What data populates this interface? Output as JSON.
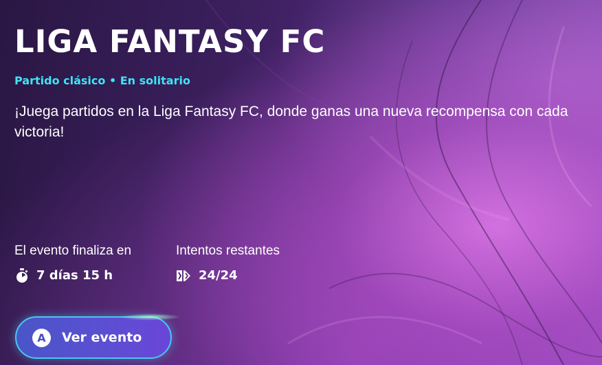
{
  "event": {
    "title": "LIGA FANTASY FC",
    "subtitle": "Partido clásico • En solitario",
    "description": "¡Juega partidos en la Liga Fantasy FC, donde ganas una nueva recompensa con cada victoria!"
  },
  "stats": {
    "end": {
      "label": "El evento finaliza en",
      "value": "7 días 15 h",
      "icon": "stopwatch-icon"
    },
    "attempts": {
      "label": "Intentos restantes",
      "value": "24/24",
      "icon": "attempts-icon"
    }
  },
  "cta": {
    "badge": "A",
    "label": "Ver evento"
  },
  "colors": {
    "accent": "#3fe4f4",
    "button": "#5b4fd2",
    "button_border": "#48c8f0"
  }
}
